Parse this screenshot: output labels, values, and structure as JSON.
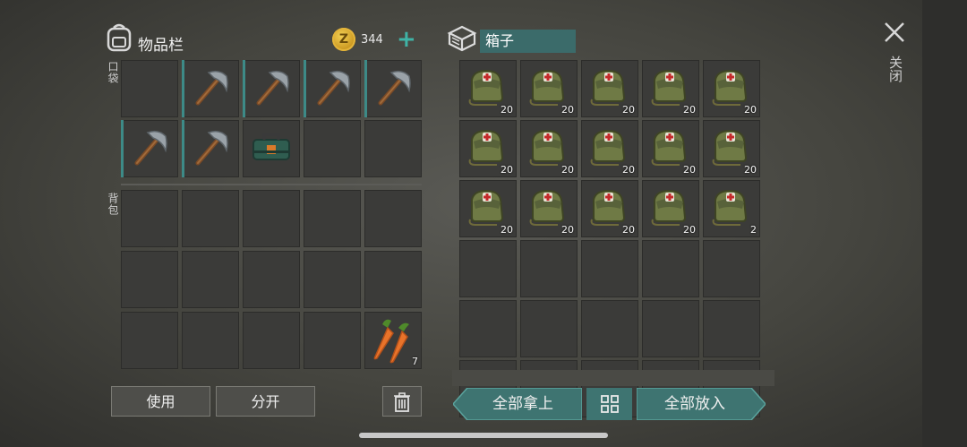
{
  "inventory": {
    "title": "物品栏",
    "coins": "344",
    "pocket_label": "口袋",
    "backpack_label": "背包",
    "pocket_slots": [
      {
        "item": "",
        "qty": ""
      },
      {
        "item": "pickaxe",
        "qty": ""
      },
      {
        "item": "pickaxe",
        "qty": ""
      },
      {
        "item": "pickaxe",
        "qty": ""
      },
      {
        "item": "pickaxe",
        "qty": ""
      },
      {
        "item": "pickaxe",
        "qty": ""
      },
      {
        "item": "pickaxe",
        "qty": ""
      },
      {
        "item": "toolbox",
        "qty": ""
      },
      {
        "item": "",
        "qty": ""
      },
      {
        "item": "",
        "qty": ""
      }
    ],
    "backpack_slots": [
      {
        "item": "",
        "qty": ""
      },
      {
        "item": "",
        "qty": ""
      },
      {
        "item": "",
        "qty": ""
      },
      {
        "item": "",
        "qty": ""
      },
      {
        "item": "",
        "qty": ""
      },
      {
        "item": "",
        "qty": ""
      },
      {
        "item": "",
        "qty": ""
      },
      {
        "item": "",
        "qty": ""
      },
      {
        "item": "",
        "qty": ""
      },
      {
        "item": "",
        "qty": ""
      },
      {
        "item": "",
        "qty": ""
      },
      {
        "item": "",
        "qty": ""
      },
      {
        "item": "",
        "qty": ""
      },
      {
        "item": "",
        "qty": ""
      },
      {
        "item": "carrot",
        "qty": "7"
      }
    ],
    "use_button": "使用",
    "split_button": "分开"
  },
  "box": {
    "name": "箱子",
    "slots": [
      {
        "item": "medbag",
        "qty": "20"
      },
      {
        "item": "medbag",
        "qty": "20"
      },
      {
        "item": "medbag",
        "qty": "20"
      },
      {
        "item": "medbag",
        "qty": "20"
      },
      {
        "item": "medbag",
        "qty": "20"
      },
      {
        "item": "medbag",
        "qty": "20"
      },
      {
        "item": "medbag",
        "qty": "20"
      },
      {
        "item": "medbag",
        "qty": "20"
      },
      {
        "item": "medbag",
        "qty": "20"
      },
      {
        "item": "medbag",
        "qty": "20"
      },
      {
        "item": "medbag",
        "qty": "20"
      },
      {
        "item": "medbag",
        "qty": "20"
      },
      {
        "item": "medbag",
        "qty": "20"
      },
      {
        "item": "medbag",
        "qty": "20"
      },
      {
        "item": "medbag",
        "qty": "2"
      },
      {
        "item": "",
        "qty": ""
      },
      {
        "item": "",
        "qty": ""
      },
      {
        "item": "",
        "qty": ""
      },
      {
        "item": "",
        "qty": ""
      },
      {
        "item": "",
        "qty": ""
      },
      {
        "item": "",
        "qty": ""
      },
      {
        "item": "",
        "qty": ""
      },
      {
        "item": "",
        "qty": ""
      },
      {
        "item": "",
        "qty": ""
      },
      {
        "item": "",
        "qty": ""
      },
      {
        "item": "",
        "qty": ""
      },
      {
        "item": "",
        "qty": ""
      },
      {
        "item": "",
        "qty": ""
      },
      {
        "item": "",
        "qty": ""
      },
      {
        "item": "",
        "qty": ""
      }
    ],
    "take_all_button": "全部拿上",
    "put_all_button": "全部放入"
  },
  "close_label": "关闭",
  "colors": {
    "accent": "#3e7471",
    "slot": "#3b3b39",
    "teal_edge": "#3d8a87"
  }
}
